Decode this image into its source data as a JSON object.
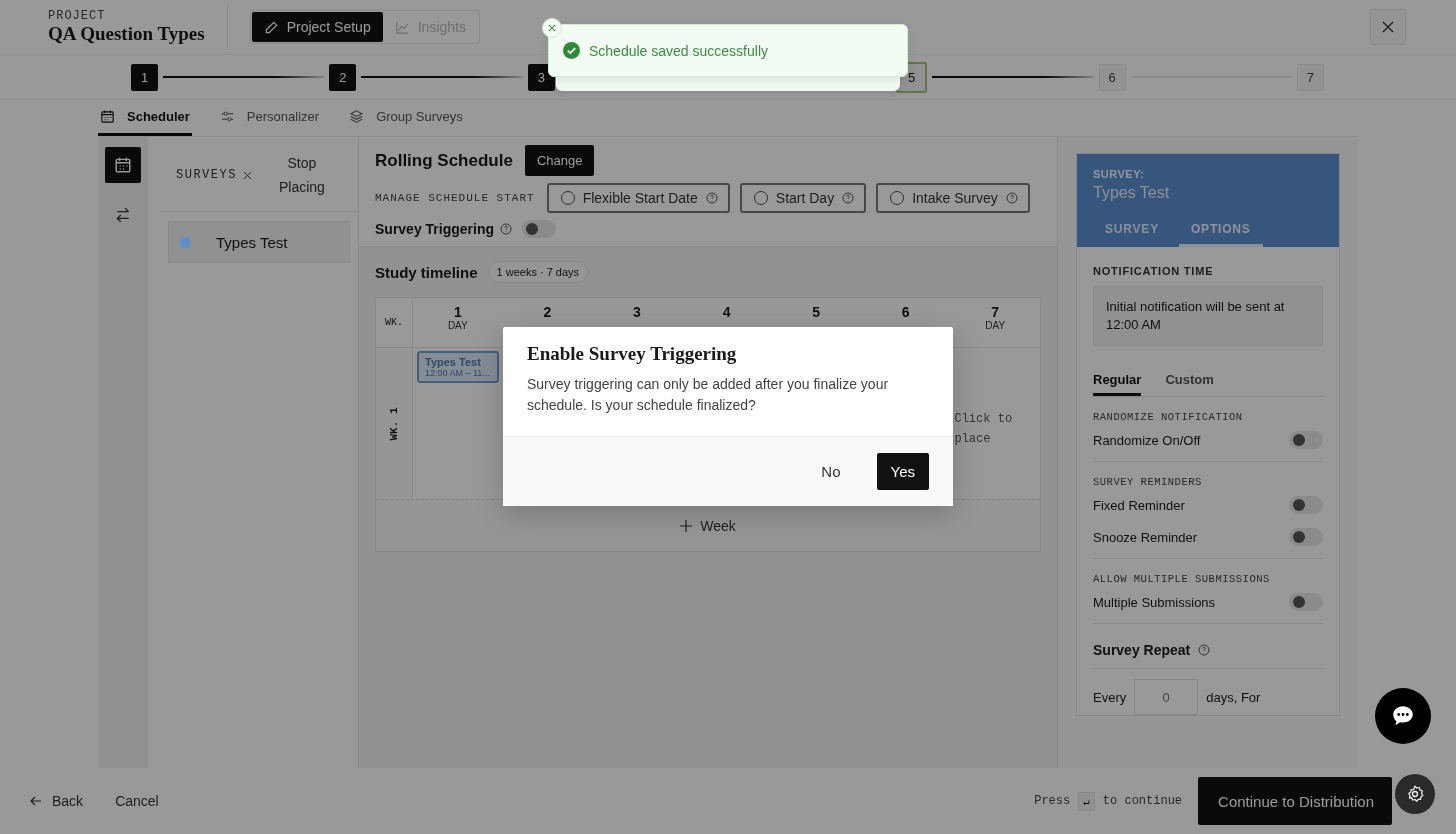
{
  "header": {
    "eyebrow": "PROJECT",
    "title": "QA Question Types",
    "modes": [
      {
        "label": "Project Setup",
        "selected": true,
        "disabled": false
      },
      {
        "label": "Insights",
        "selected": false,
        "disabled": true
      }
    ]
  },
  "stepper": [
    {
      "label": "1",
      "done": true,
      "current": false
    },
    {
      "label": "2",
      "done": true,
      "current": false
    },
    {
      "label": "3",
      "done": true,
      "current": false
    },
    {
      "label": "5",
      "done": false,
      "current": true
    },
    {
      "label": "6",
      "done": false,
      "current": false
    },
    {
      "label": "7",
      "done": false,
      "current": false
    }
  ],
  "tabs": [
    {
      "label": "Scheduler",
      "kind": "calendar",
      "selected": true
    },
    {
      "label": "Personalizer",
      "kind": "sliders",
      "selected": false
    },
    {
      "label": "Group Surveys",
      "kind": "layers",
      "selected": false
    }
  ],
  "rail": [
    {
      "kind": "calendar",
      "selected": true
    },
    {
      "kind": "swap",
      "selected": false
    }
  ],
  "surveys": {
    "heading": "SURVEYS",
    "action": "Stop Placing",
    "items": [
      {
        "name": "Types Test",
        "color": "#5b8fc9",
        "selected": true
      }
    ]
  },
  "schedule": {
    "title": "Rolling Schedule",
    "change": "Change",
    "start_label": "MANAGE SCHEDULE START",
    "start_options": [
      {
        "label": "Flexible Start Date",
        "selected": false
      },
      {
        "label": "Start Day",
        "selected": false
      },
      {
        "label": "Intake Survey",
        "selected": false
      }
    ],
    "triggering": {
      "label": "Survey Triggering",
      "on": false
    }
  },
  "timeline": {
    "title": "Study timeline",
    "badge": "1 weeks · 7 days",
    "week_header": "WK.",
    "days": [
      {
        "number": "1",
        "label": "DAY"
      },
      {
        "number": "2"
      },
      {
        "number": "3"
      },
      {
        "number": "4"
      },
      {
        "number": "5"
      },
      {
        "number": "6"
      },
      {
        "number": "7",
        "label": "DAY"
      }
    ],
    "weeks": [
      {
        "label": "WK. 1",
        "cells": [
          {
            "kind": "event",
            "title": "Types Test",
            "time": "12:00 AM – 11..."
          },
          {
            "kind": "empty"
          },
          {
            "kind": "empty"
          },
          {
            "kind": "empty"
          },
          {
            "kind": "empty"
          },
          {
            "kind": "empty"
          },
          {
            "kind": "hint",
            "text": "Click to place"
          }
        ]
      }
    ],
    "add_week": "Week"
  },
  "options": {
    "eyebrow": "SURVEY:",
    "title": "Types Test",
    "tabs": [
      {
        "label": "SURVEY",
        "selected": false
      },
      {
        "label": "OPTIONS",
        "selected": true
      }
    ],
    "notification_heading": "NOTIFICATION TIME",
    "notification_text": "Initial notification will be sent at 12:00 AM",
    "mode_tabs": [
      {
        "label": "Regular",
        "selected": true
      },
      {
        "label": "Custom",
        "selected": false
      }
    ],
    "groups": [
      {
        "heading": "RANDOMIZE NOTIFICATION",
        "toggles": [
          {
            "label": "Randomize On/Off",
            "on": false
          }
        ]
      },
      {
        "heading": "SURVEY REMINDERS",
        "toggles": [
          {
            "label": "Fixed Reminder",
            "on": false
          },
          {
            "label": "Snooze Reminder",
            "on": false
          }
        ]
      },
      {
        "heading": "ALLOW MULTIPLE SUBMISSIONS",
        "toggles": [
          {
            "label": "Multiple Submissions",
            "on": false
          }
        ]
      }
    ],
    "repeat": {
      "title": "Survey Repeat",
      "every": "Every",
      "placeholder": "0",
      "suffix": "days, For"
    }
  },
  "footer": {
    "back": "Back",
    "cancel": "Cancel",
    "hint_before": "Press",
    "key": "↵",
    "hint_after": "to continue",
    "primary": "Continue to Distribution"
  },
  "toast": {
    "message": "Schedule saved successfully"
  },
  "modal": {
    "title": "Enable Survey Triggering",
    "body": "Survey triggering can only be added after you finalize your schedule. Is your schedule finalized?",
    "buttons": [
      {
        "label": "No",
        "kind": "secondary"
      },
      {
        "label": "Yes",
        "kind": "primary"
      }
    ]
  }
}
